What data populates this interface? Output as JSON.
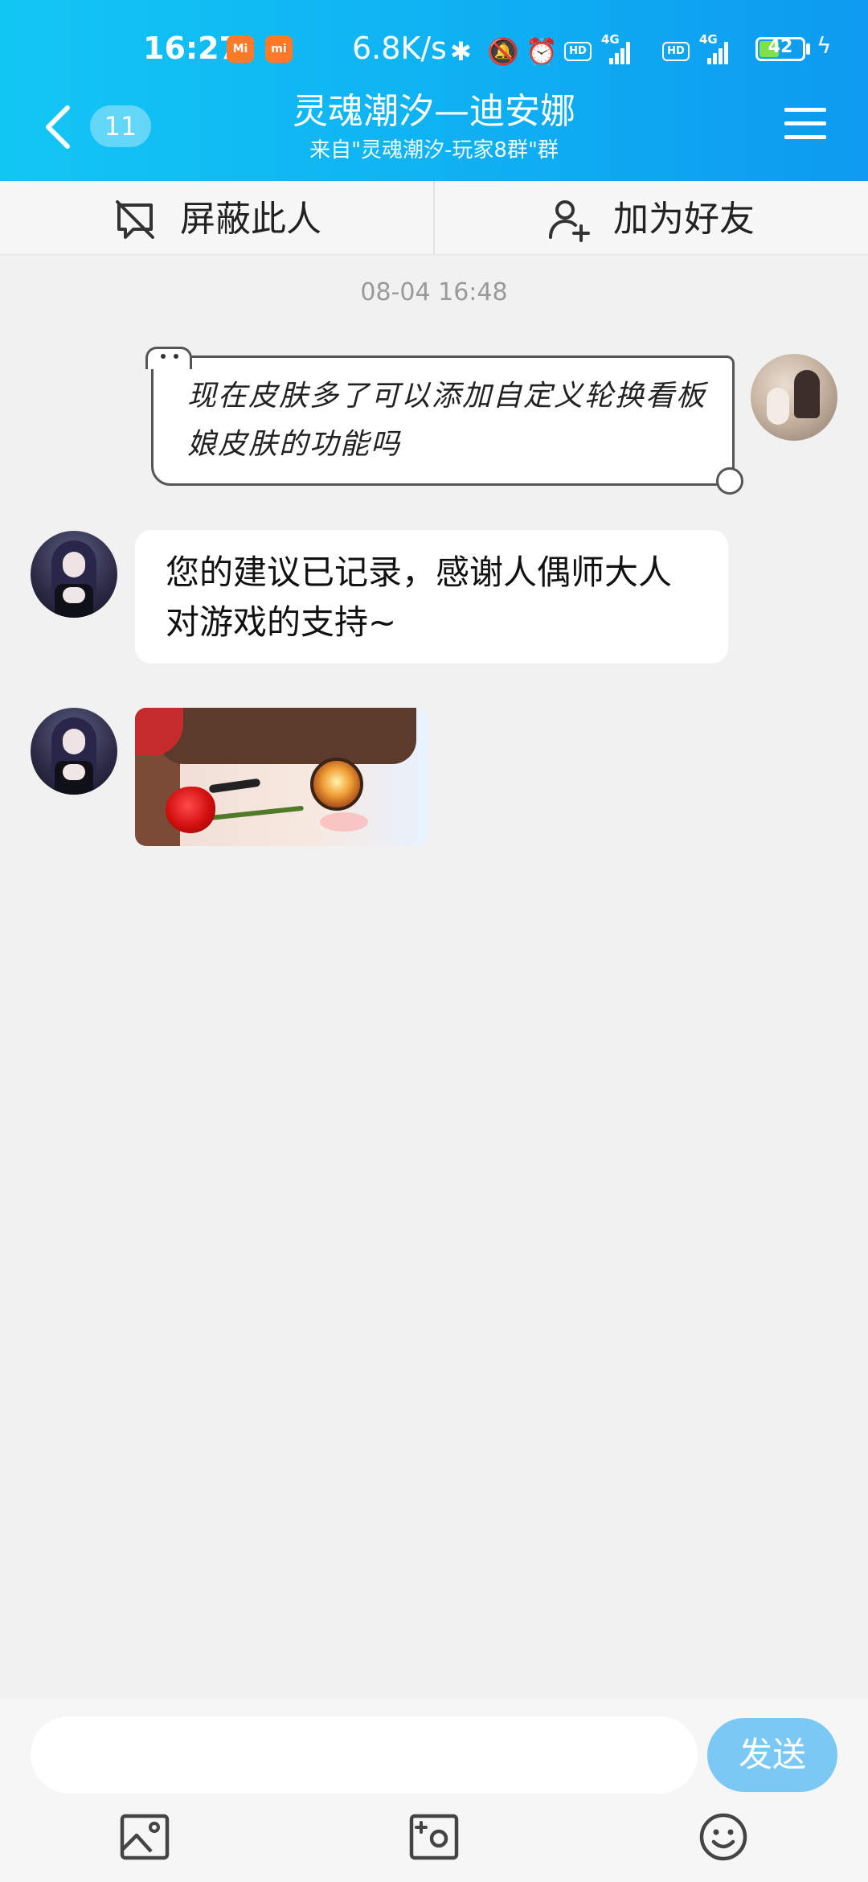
{
  "status_bar": {
    "time": "16:27",
    "net_speed": "6.8K/s",
    "hd_label": "HD",
    "net_type": "4G",
    "battery": "42",
    "app_badges": [
      "Mi",
      "mi"
    ]
  },
  "header": {
    "unread_count": "11",
    "title": "灵魂潮汐—迪安娜",
    "subtitle": "来自\"灵魂潮汐-玩家8群\"群"
  },
  "actions": {
    "block_label": "屏蔽此人",
    "add_friend_label": "加为好友"
  },
  "chat": {
    "timestamp": "08-04 16:48",
    "messages": [
      {
        "sender": "me",
        "text": "现在皮肤多了可以添加自定义轮换看板娘皮肤的功能吗"
      },
      {
        "sender": "bot",
        "text": "您的建议已记录，感谢人偶师大人对游戏的支持~"
      },
      {
        "sender": "bot",
        "type": "sticker"
      }
    ]
  },
  "input": {
    "placeholder": "",
    "send_label": "发送"
  },
  "colors": {
    "header_start": "#12c6f4",
    "header_end": "#0d9af0",
    "send_button": "#7cc8f5",
    "background": "#f1f1f1"
  },
  "icons": [
    "back-icon",
    "menu-icon",
    "block-icon",
    "add-friend-icon",
    "image-icon",
    "camera-icon",
    "emoji-icon"
  ]
}
